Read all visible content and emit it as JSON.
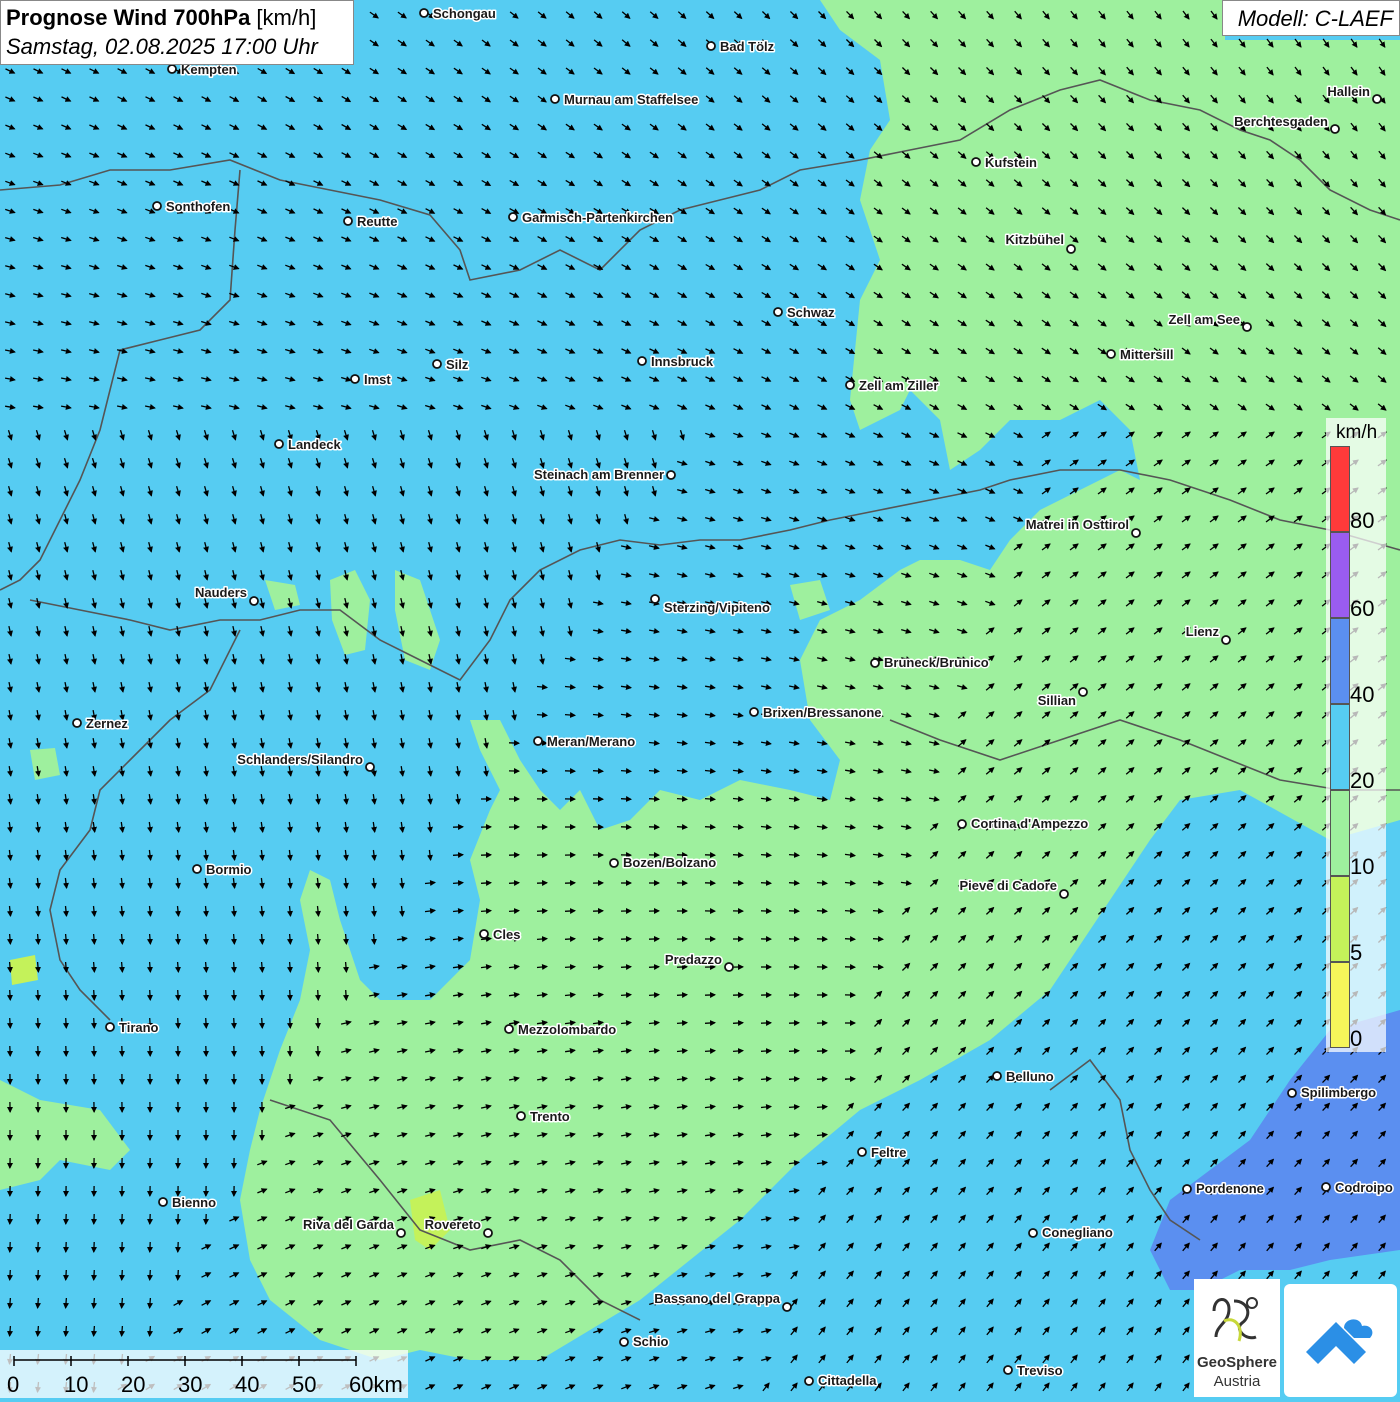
{
  "header": {
    "title_bold": "Prognose Wind 700hPa",
    "title_unit": " [km/h]",
    "datetime": "Samstag, 02.08.2025 17:00 Uhr",
    "model": "Modell: C-LAEF"
  },
  "legend": {
    "unit": "km/h",
    "bins": [
      {
        "label": "0",
        "color": "#f5f55a"
      },
      {
        "label": "5",
        "color": "#c4f25a"
      },
      {
        "label": "10",
        "color": "#9ef09e"
      },
      {
        "label": "20",
        "color": "#56ccf2"
      },
      {
        "label": "40",
        "color": "#5b8ff0"
      },
      {
        "label": "60",
        "color": "#9a5cf0"
      },
      {
        "label": "80",
        "color": "#ff3a3a"
      }
    ]
  },
  "scale_bar": {
    "labels": [
      "0",
      "10",
      "20",
      "30",
      "40",
      "50",
      "60km"
    ]
  },
  "logos": {
    "geosphere_line1": "GeoSphere",
    "geosphere_line2": "Austria"
  },
  "cities": [
    {
      "name": "Schongau"
    },
    {
      "name": "Bad Tölz"
    },
    {
      "name": "Kempten"
    },
    {
      "name": "Murnau am Staffelsee"
    },
    {
      "name": "Hallein"
    },
    {
      "name": "Berchtesgaden"
    },
    {
      "name": "Kufstein"
    },
    {
      "name": "Sonthofen"
    },
    {
      "name": "Reutte"
    },
    {
      "name": "Garmisch-Partenkirchen"
    },
    {
      "name": "Kitzbühel"
    },
    {
      "name": "Schwaz"
    },
    {
      "name": "Zell am See"
    },
    {
      "name": "Innsbruck"
    },
    {
      "name": "Mittersill"
    },
    {
      "name": "Silz"
    },
    {
      "name": "Imst"
    },
    {
      "name": "Zell am Ziller"
    },
    {
      "name": "Landeck"
    },
    {
      "name": "Steinach am Brenner"
    },
    {
      "name": "Matrei in Osttirol"
    },
    {
      "name": "Nauders"
    },
    {
      "name": "Sterzing/Vipiteno"
    },
    {
      "name": "Lienz"
    },
    {
      "name": "Bruneck/Brunico"
    },
    {
      "name": "Sillian"
    },
    {
      "name": "Zernez"
    },
    {
      "name": "Brixen/Bressanone"
    },
    {
      "name": "Meran/Merano"
    },
    {
      "name": "Schlanders/Silandro"
    },
    {
      "name": "Cortina d'Ampezzo"
    },
    {
      "name": "Bozen/Bolzano"
    },
    {
      "name": "Bormio"
    },
    {
      "name": "Pieve di Cadore"
    },
    {
      "name": "Cles"
    },
    {
      "name": "Predazzo"
    },
    {
      "name": "Tirano"
    },
    {
      "name": "Mezzolombardo"
    },
    {
      "name": "Belluno"
    },
    {
      "name": "Spilimbergo"
    },
    {
      "name": "Trento"
    },
    {
      "name": "Feltre"
    },
    {
      "name": "Pordenone"
    },
    {
      "name": "Codroipo"
    },
    {
      "name": "Bienno"
    },
    {
      "name": "Riva del Garda"
    },
    {
      "name": "Rovereto"
    },
    {
      "name": "Conegliano"
    },
    {
      "name": "Bassano del Grappa"
    },
    {
      "name": "Schio"
    },
    {
      "name": "Treviso"
    },
    {
      "name": "Cittadella"
    }
  ]
}
